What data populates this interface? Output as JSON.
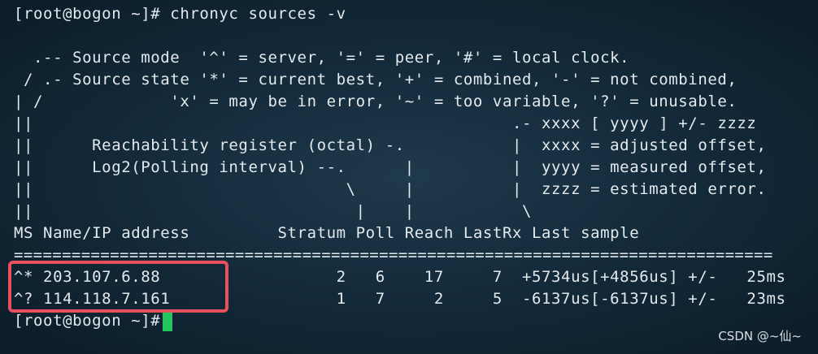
{
  "terminal": {
    "command_line": "[root@bogon ~]# chronyc sources -v",
    "legend": [
      "",
      "  .-- Source mode  '^' = server, '=' = peer, '#' = local clock.",
      " / .- Source state '*' = current best, '+' = combined, '-' = not combined,",
      "| /             'x' = may be in error, '~' = too variable, '?' = unusable.",
      "||                                                 .- xxxx [ yyyy ] +/- zzzz",
      "||      Reachability register (octal) -.           |  xxxx = adjusted offset,",
      "||      Log2(Polling interval) --.      |          |  yyyy = measured offset,",
      "||                                \\     |          |  zzzz = estimated error.",
      "||                                 |    |           \\"
    ],
    "header": "MS Name/IP address         Stratum Poll Reach LastRx Last sample",
    "separator": "===============================================================================",
    "rows": [
      "^* 203.107.6.88                  2   6    17     7  +5734us[+4856us] +/-   25ms",
      "^? 114.118.7.161                 1   7     2     5  -6137us[-6137us] +/-   23ms"
    ],
    "prompt": "[root@bogon ~]# "
  },
  "colors": {
    "background": "#142b3b",
    "text": "#e3eaee",
    "cursor": "#22c55e",
    "highlight_border": "#e8505e"
  },
  "watermark": "CSDN @~仙~"
}
